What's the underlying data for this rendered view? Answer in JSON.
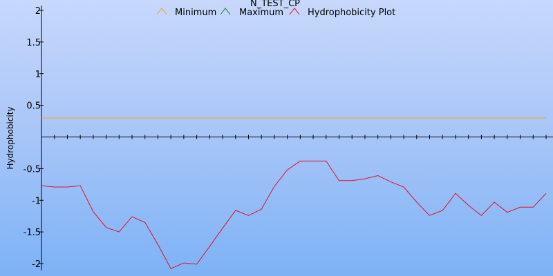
{
  "chart_data": {
    "type": "line",
    "title": "N_TEST_CP",
    "ylabel": "Hydrophobicity",
    "xlabel": "",
    "ylim": [
      -2,
      2
    ],
    "yticks": [
      2,
      1.5,
      1,
      0.5,
      -0.5,
      -1,
      -1.5,
      -2
    ],
    "ytick_labels": [
      "2",
      "1.5",
      "1",
      "0.5",
      "-0.5",
      "-1",
      "-1.5",
      "-2"
    ],
    "xlim": [
      0,
      39
    ],
    "x_minor_ticks": 40,
    "legend": {
      "placement": "top-center",
      "entries": [
        "Minimum",
        "Maximum",
        "Hydrophobicity Plot"
      ]
    },
    "series": [
      {
        "name": "Minimum",
        "color": "#f0a030",
        "values": [
          0.3,
          0.3
        ],
        "x": [
          0,
          39
        ]
      },
      {
        "name": "Maximum",
        "color": "#1a8a1a",
        "values": [],
        "x": []
      },
      {
        "name": "Hydrophobicity Plot",
        "color": "#e0102a",
        "x": [
          0,
          1,
          2,
          3,
          4,
          5,
          6,
          7,
          8,
          9,
          10,
          11,
          12,
          13,
          14,
          15,
          16,
          17,
          18,
          19,
          20,
          21,
          22,
          23,
          24,
          25,
          26,
          27,
          28,
          29,
          30,
          31,
          32,
          33,
          34,
          35,
          36,
          37,
          38,
          39
        ],
        "values": [
          -0.77,
          -0.79,
          -0.79,
          -0.77,
          -1.18,
          -1.43,
          -1.5,
          -1.26,
          -1.35,
          -1.7,
          -2.08,
          -1.99,
          -2.01,
          -1.73,
          -1.44,
          -1.16,
          -1.24,
          -1.14,
          -0.78,
          -0.52,
          -0.38,
          -0.38,
          -0.38,
          -0.69,
          -0.69,
          -0.66,
          -0.61,
          -0.71,
          -0.79,
          -1.03,
          -1.24,
          -1.16,
          -0.89,
          -1.08,
          -1.24,
          -1.03,
          -1.19,
          -1.11,
          -1.11,
          -0.89
        ]
      }
    ]
  }
}
